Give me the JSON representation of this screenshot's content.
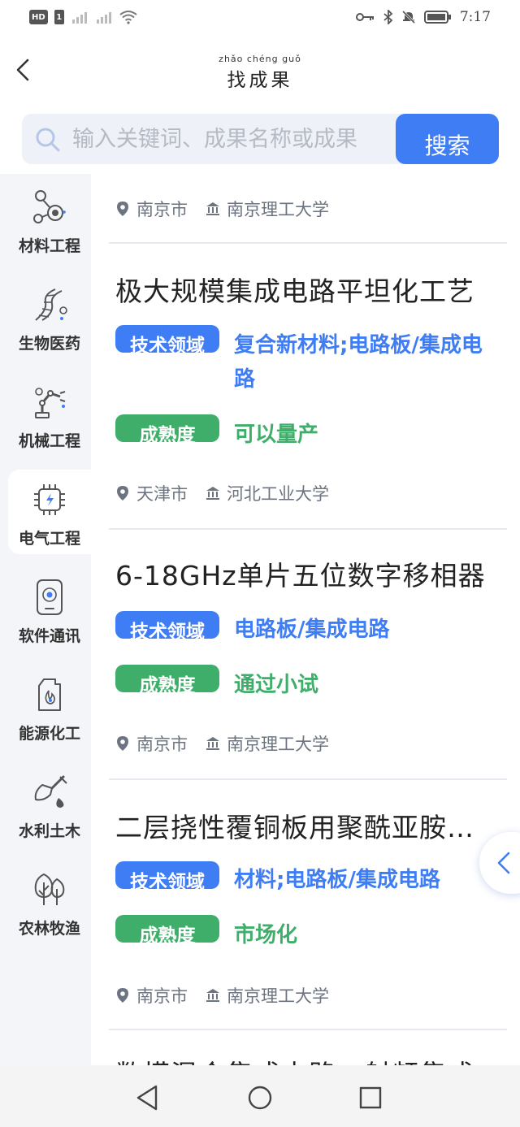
{
  "status_bar": {
    "hd": "HD",
    "sim": "1",
    "time": "7:17"
  },
  "header": {
    "pinyin": "zhǎo chéng guǒ",
    "title": "找成果"
  },
  "search": {
    "placeholder": "输入关键词、成果名称或成果",
    "button_label": "搜索"
  },
  "categories": [
    {
      "label": "材料工程",
      "icon": "molecule-icon"
    },
    {
      "label": "生物医药",
      "icon": "dna-icon"
    },
    {
      "label": "机械工程",
      "icon": "robot-arm-icon"
    },
    {
      "label": "电气工程",
      "icon": "chip-icon",
      "active": true
    },
    {
      "label": "软件通讯",
      "icon": "phone-icon"
    },
    {
      "label": "能源化工",
      "icon": "fuel-can-icon"
    },
    {
      "label": "水利土木",
      "icon": "shovel-icon"
    },
    {
      "label": "农林牧渔",
      "icon": "tree-icon"
    }
  ],
  "top_meta": {
    "city": "南京市",
    "org": "南京理工大学"
  },
  "cards": [
    {
      "title": "极大规模集成电路平坦化工艺",
      "field_tag": "技术领域",
      "field": "复合新材料;电路板/集成电路",
      "maturity_tag": "成熟度",
      "maturity": "可以量产",
      "city": "天津市",
      "org": "河北工业大学"
    },
    {
      "title": "6-18GHz单片五位数字移相器",
      "field_tag": "技术领域",
      "field": "电路板/集成电路",
      "maturity_tag": "成熟度",
      "maturity": "通过小试",
      "city": "南京市",
      "org": "南京理工大学"
    },
    {
      "title": "二层挠性覆铜板用聚酰亚胺薄膜",
      "field_tag": "技术领域",
      "field": "材料;电路板/集成电路",
      "maturity_tag": "成熟度",
      "maturity": "市场化",
      "city": "南京市",
      "org": "南京理工大学"
    }
  ],
  "next_card_title": "数模混合集成电路、射频集成",
  "colors": {
    "accent_blue": "#3f7df5",
    "accent_green": "#3fae6a",
    "sidebar_bg": "#f3f5f9"
  }
}
